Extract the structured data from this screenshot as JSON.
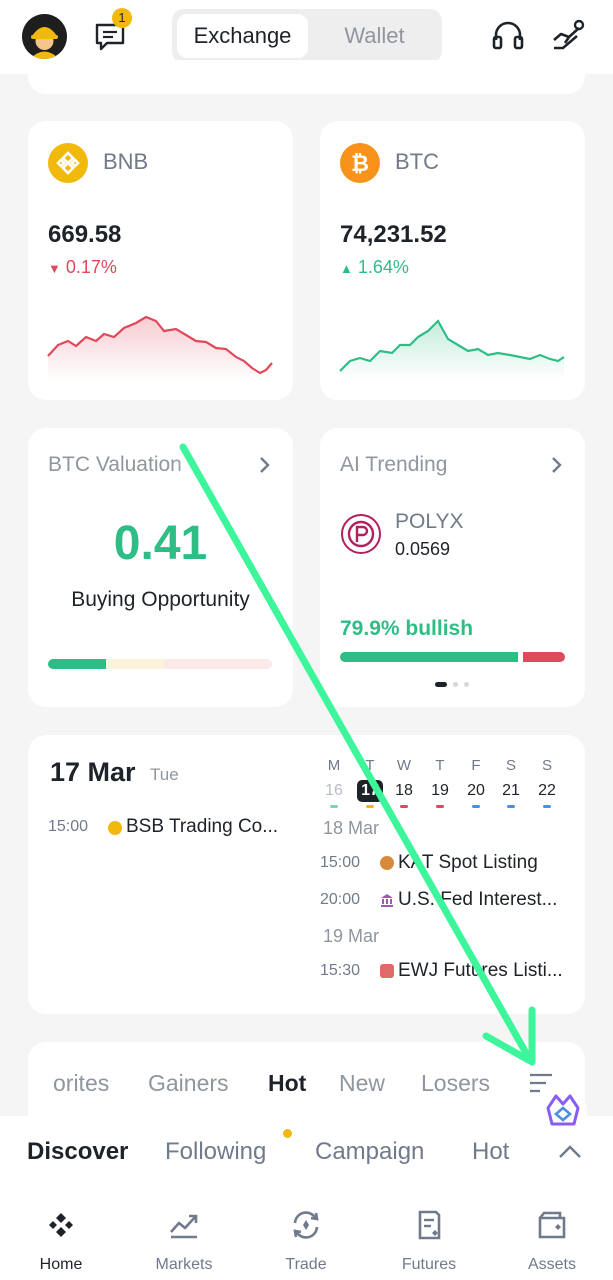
{
  "header": {
    "notification_count": "1",
    "segment_tabs": [
      "Exchange",
      "Wallet"
    ],
    "active_segment": "Exchange"
  },
  "coins": [
    {
      "symbol": "BNB",
      "price": "669.58",
      "change": "0.17%",
      "direction": "down",
      "logo_color": "#f0b90b"
    },
    {
      "symbol": "BTC",
      "price": "74,231.52",
      "change": "1.64%",
      "direction": "up",
      "logo_color": "#f7931a"
    }
  ],
  "valuation": {
    "title": "BTC Valuation",
    "value": "0.41",
    "label": "Buying Opportunity"
  },
  "ai_trending": {
    "title": "AI Trending",
    "token": "POLYX",
    "price": "0.0569",
    "sentiment": "79.9% bullish",
    "bullish_fraction": 0.799
  },
  "calendar": {
    "date": "17 Mar",
    "weekday": "Tue",
    "today_events": [
      {
        "time": "15:00",
        "title": "BSB Trading Co..."
      }
    ],
    "week_letters": [
      "M",
      "T",
      "W",
      "T",
      "F",
      "S",
      "S"
    ],
    "week_days": [
      "16",
      "17",
      "18",
      "19",
      "20",
      "21",
      "22"
    ],
    "upcoming": [
      {
        "day": "18 Mar",
        "events": [
          {
            "time": "15:00",
            "title": "KAT Spot Listing"
          },
          {
            "time": "20:00",
            "title": "U.S. Fed Interest..."
          }
        ]
      },
      {
        "day": "19 Mar",
        "events": [
          {
            "time": "15:30",
            "title": "EWJ Futures Listi..."
          }
        ]
      }
    ]
  },
  "market_tabs": [
    "orites",
    "Gainers",
    "Hot",
    "New",
    "Losers"
  ],
  "active_market_tab": "Hot",
  "discover_tabs": [
    "Discover",
    "Following",
    "Campaign",
    "Hot"
  ],
  "active_discover_tab": "Discover",
  "bottom_nav": [
    {
      "label": "Home",
      "icon": "home-icon"
    },
    {
      "label": "Markets",
      "icon": "markets-icon"
    },
    {
      "label": "Trade",
      "icon": "trade-icon"
    },
    {
      "label": "Futures",
      "icon": "futures-icon"
    },
    {
      "label": "Assets",
      "icon": "assets-icon"
    }
  ],
  "active_nav": "Home",
  "colors": {
    "accent": "#f0b90b",
    "up": "#2ebd85",
    "down": "#e0485c",
    "annotation_arrow": "#3df59a"
  }
}
